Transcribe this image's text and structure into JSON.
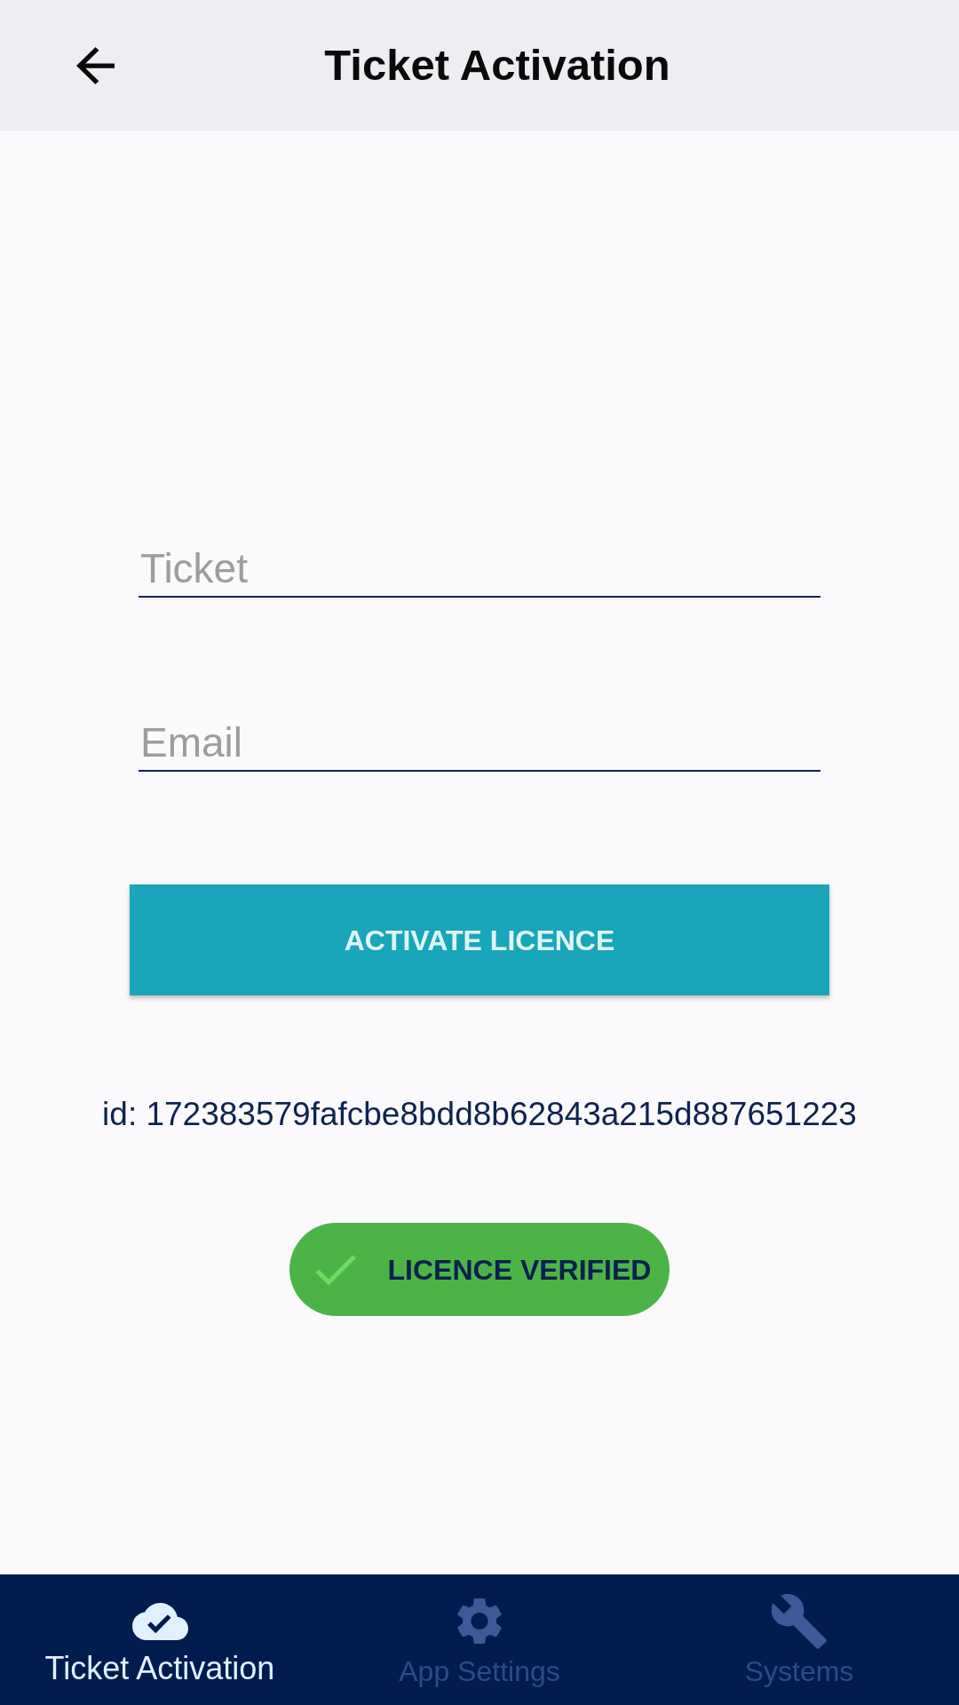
{
  "app_bar": {
    "title": "Ticket Activation"
  },
  "form": {
    "fields": [
      {
        "placeholder": "Ticket"
      },
      {
        "placeholder": "Email"
      }
    ],
    "submit_button": "ACTIVATE LICENCE",
    "device_id": "id: 172383579fafcbe8bdd8b62843a215d887651223",
    "status": {
      "label": "LICENCE VERIFIED",
      "verified": true
    }
  },
  "bottom_nav": [
    {
      "label": "Ticket Activation",
      "kind": "cloud-check",
      "selected": true
    },
    {
      "label": "App Settings",
      "kind": "gear",
      "selected": false
    },
    {
      "label": "Systems",
      "kind": "wrench",
      "selected": false
    }
  ]
}
